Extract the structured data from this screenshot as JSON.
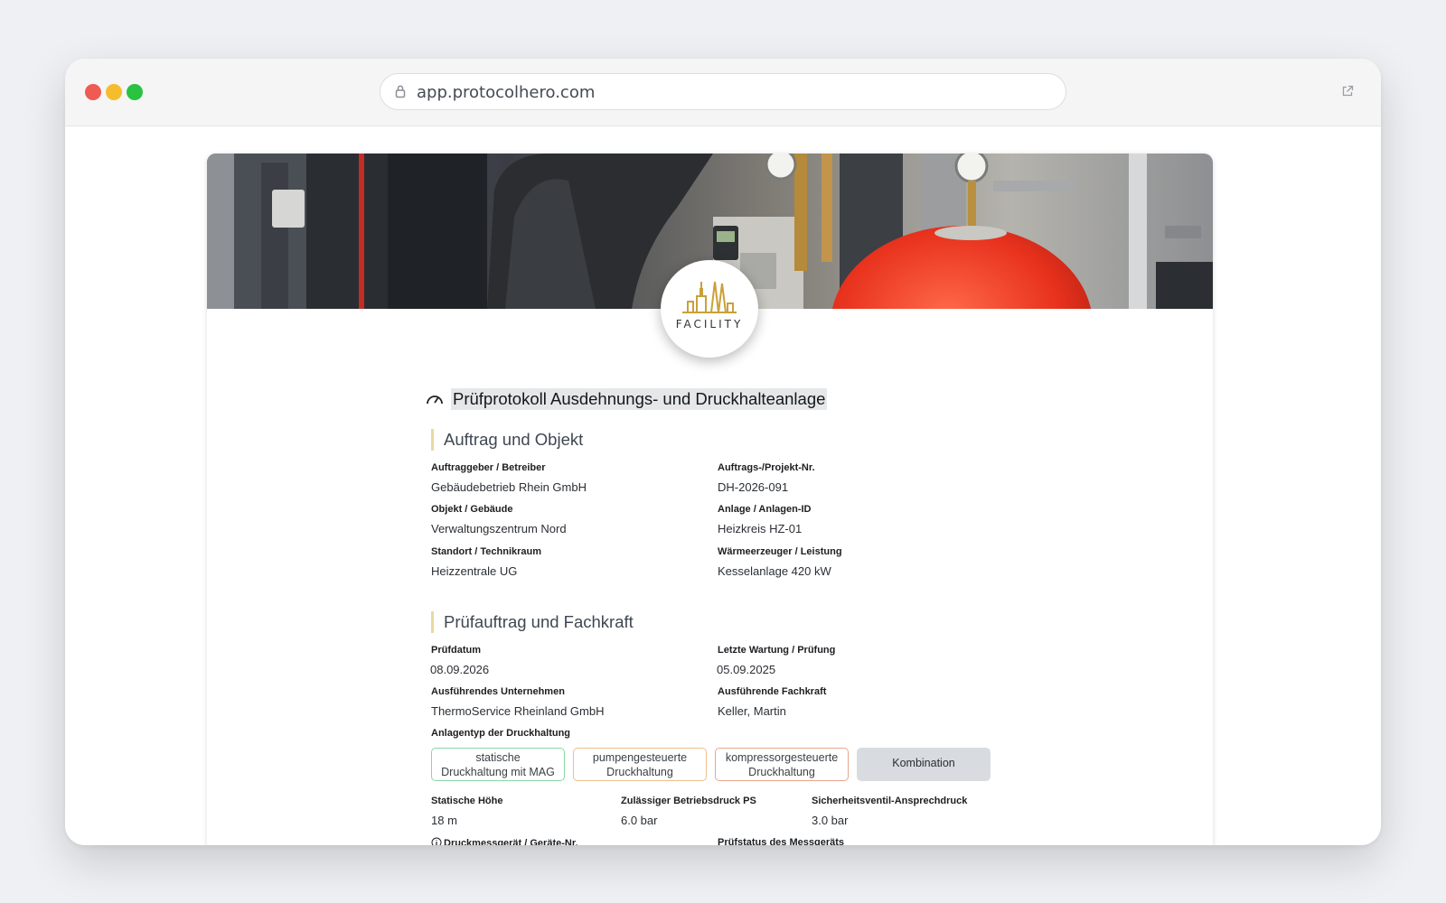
{
  "browser": {
    "url": "app.protocolhero.com"
  },
  "logo": {
    "text": "FACILITY"
  },
  "document": {
    "title": "Prüfprotokoll Ausdehnungs- und Druckhalteanlage"
  },
  "section1": {
    "heading": "Auftrag und Objekt",
    "fields": [
      {
        "label": "Auftraggeber / Betreiber",
        "value": "Gebäudebetrieb Rhein GmbH"
      },
      {
        "label": "Auftrags-/Projekt-Nr.",
        "value": "DH-2026-091"
      },
      {
        "label": "Objekt / Gebäude",
        "value": "Verwaltungszentrum Nord"
      },
      {
        "label": "Anlage / Anlagen-ID",
        "value": "Heizkreis HZ-01"
      },
      {
        "label": "Standort / Technikraum",
        "value": "Heizzentrale UG"
      },
      {
        "label": "Wärmeerzeuger / Leistung",
        "value": "Kesselanlage 420 kW"
      }
    ]
  },
  "section2": {
    "heading": "Prüfauftrag und Fachkraft",
    "fields": [
      {
        "label": "Prüfdatum",
        "value": "08.09.2026"
      },
      {
        "label": "Letzte Wartung / Prüfung",
        "value": "05.09.2025"
      },
      {
        "label": "Ausführendes Unternehmen",
        "value": "ThermoService Rheinland GmbH"
      },
      {
        "label": "Ausführende Fachkraft",
        "value": "Keller, Martin"
      }
    ],
    "type_label": "Anlagentyp der Druckhaltung",
    "type_options": [
      {
        "line1": "statische",
        "line2": "Druckhaltung mit MAG"
      },
      {
        "line1": "pumpengesteuerte",
        "line2": "Druckhaltung"
      },
      {
        "line1": "kompressorgesteuerte",
        "line2": "Druckhaltung"
      },
      {
        "line1": "Kombination",
        "line2": ""
      }
    ],
    "pressure_fields": [
      {
        "label": "Statische Höhe",
        "value": "18 m"
      },
      {
        "label": "Zulässiger Betriebsdruck PS",
        "value": "6.0 bar"
      },
      {
        "label": "Sicherheitsventil-Ansprechdruck",
        "value": "3.0 bar"
      }
    ],
    "device_label": "Druckmessgerät / Geräte-Nr.",
    "device_status_label": "Prüfstatus des Messgeräts"
  },
  "colors": {
    "section_accent": "#ead8a3",
    "chip_green": "#8ad6a6",
    "chip_orange": "#eebf8d",
    "chip_red": "#eaa58e",
    "chip_selected_bg": "#d8dbe0",
    "logo_gold": "#c9a03a"
  }
}
